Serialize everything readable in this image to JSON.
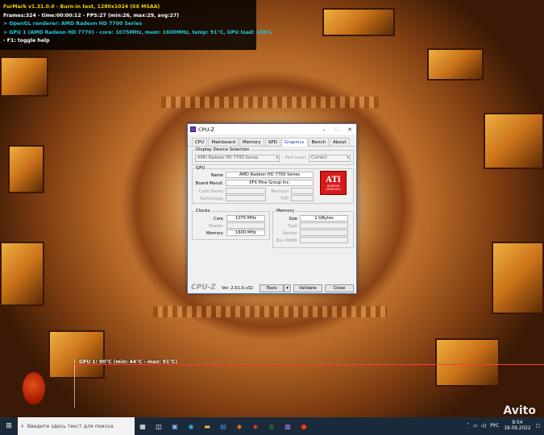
{
  "furmark": {
    "line1": "FurMark v1.31.0.0 - Burn-in test, 1280x1024 (0X MSAA)",
    "line2": "Frames:324 - time:00:00:12 - FPS:27 (min:26, max:29, avg:27)",
    "line3": "> OpenGL renderer: AMD Radeon HD 7700 Series",
    "line4": "> GPU 1 (AMD Radeon HD 7770) - core: 1075MHz, mem: 1600MHz, temp: 91°C, GPU load: 100%",
    "line5": "- F1: toggle help",
    "graph_label": "GPU 1: 90°C (min: 44°C - max: 91°C)"
  },
  "cpuz": {
    "title": "CPU-Z",
    "tabs": [
      "CPU",
      "Mainboard",
      "Memory",
      "SPD",
      "Graphics",
      "Bench",
      "About"
    ],
    "active_tab": "Graphics",
    "display_group": "Display Device Selection",
    "device_select": "AMD Radeon HD 7700 Series",
    "perf_label": "Perf Level",
    "perf_select": "Current",
    "gpu_group": "GPU",
    "name_label": "Name",
    "name_value": "AMD Radeon HD 7700 Series",
    "board_label": "Board Manuf.",
    "board_value": "XFX Pine Group Inc.",
    "codename_label": "Code Name",
    "revision_label": "Revision",
    "technology_label": "Technology",
    "tdp_label": "TDP",
    "ati_logo": "ATi",
    "ati_sub": "RADEON",
    "ati_sub2": "GRAPHICS",
    "clocks_group": "Clocks",
    "core_label": "Core",
    "core_value": "1075 MHz",
    "shader_label": "Shader",
    "memory_clk_label": "Memory",
    "memory_clk_value": "1600 MHz",
    "memory_group": "Memory",
    "size_label": "Size",
    "size_value": "1 GBytes",
    "type_label": "Type",
    "vendor_label": "Vendor",
    "buswidth_label": "Bus Width",
    "footer_logo": "CPU-Z",
    "version": "Ver. 2.01.0.x32",
    "tools_button": "Tools",
    "validate_button": "Validate",
    "close_button": "Close"
  },
  "taskbar": {
    "search_placeholder": "Введите здесь текст для поиска",
    "lang": "РУС",
    "time": "8:54",
    "date": "18.09.2022"
  },
  "watermark": "Avito"
}
